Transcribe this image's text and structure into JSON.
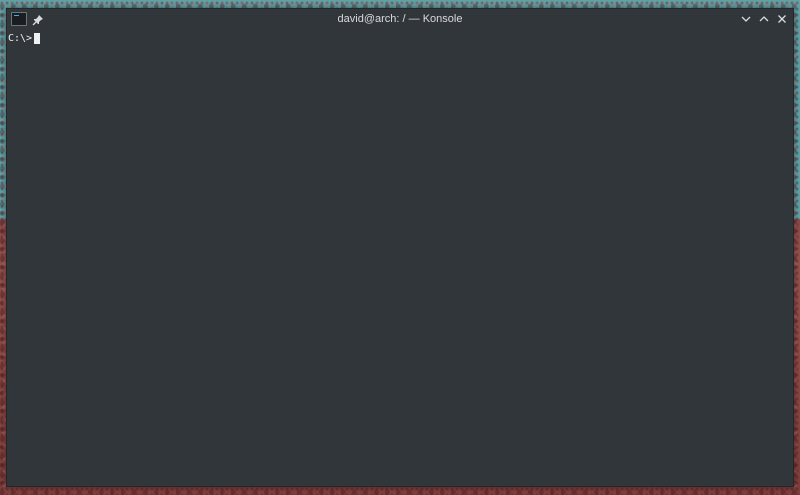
{
  "window": {
    "title": "david@arch: / — Konsole",
    "app_icon": "terminal-icon",
    "pin_icon": "pin-icon",
    "buttons": {
      "minimize_icon": "chevron-down-icon",
      "maximize_icon": "chevron-up-icon",
      "close_icon": "close-icon"
    }
  },
  "terminal": {
    "prompt": "C:\\>",
    "input": ""
  },
  "colors": {
    "window_bg": "#31363b",
    "text": "#eff0f1",
    "sky": "#5fa3a9",
    "ground": "#8c4a4a"
  }
}
